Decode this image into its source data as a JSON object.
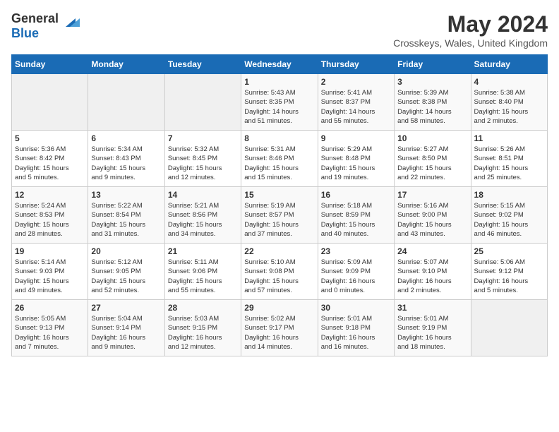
{
  "header": {
    "logo_general": "General",
    "logo_blue": "Blue",
    "month_year": "May 2024",
    "location": "Crosskeys, Wales, United Kingdom"
  },
  "weekdays": [
    "Sunday",
    "Monday",
    "Tuesday",
    "Wednesday",
    "Thursday",
    "Friday",
    "Saturday"
  ],
  "weeks": [
    [
      {
        "day": "",
        "info": ""
      },
      {
        "day": "",
        "info": ""
      },
      {
        "day": "",
        "info": ""
      },
      {
        "day": "1",
        "info": "Sunrise: 5:43 AM\nSunset: 8:35 PM\nDaylight: 14 hours\nand 51 minutes."
      },
      {
        "day": "2",
        "info": "Sunrise: 5:41 AM\nSunset: 8:37 PM\nDaylight: 14 hours\nand 55 minutes."
      },
      {
        "day": "3",
        "info": "Sunrise: 5:39 AM\nSunset: 8:38 PM\nDaylight: 14 hours\nand 58 minutes."
      },
      {
        "day": "4",
        "info": "Sunrise: 5:38 AM\nSunset: 8:40 PM\nDaylight: 15 hours\nand 2 minutes."
      }
    ],
    [
      {
        "day": "5",
        "info": "Sunrise: 5:36 AM\nSunset: 8:42 PM\nDaylight: 15 hours\nand 5 minutes."
      },
      {
        "day": "6",
        "info": "Sunrise: 5:34 AM\nSunset: 8:43 PM\nDaylight: 15 hours\nand 9 minutes."
      },
      {
        "day": "7",
        "info": "Sunrise: 5:32 AM\nSunset: 8:45 PM\nDaylight: 15 hours\nand 12 minutes."
      },
      {
        "day": "8",
        "info": "Sunrise: 5:31 AM\nSunset: 8:46 PM\nDaylight: 15 hours\nand 15 minutes."
      },
      {
        "day": "9",
        "info": "Sunrise: 5:29 AM\nSunset: 8:48 PM\nDaylight: 15 hours\nand 19 minutes."
      },
      {
        "day": "10",
        "info": "Sunrise: 5:27 AM\nSunset: 8:50 PM\nDaylight: 15 hours\nand 22 minutes."
      },
      {
        "day": "11",
        "info": "Sunrise: 5:26 AM\nSunset: 8:51 PM\nDaylight: 15 hours\nand 25 minutes."
      }
    ],
    [
      {
        "day": "12",
        "info": "Sunrise: 5:24 AM\nSunset: 8:53 PM\nDaylight: 15 hours\nand 28 minutes."
      },
      {
        "day": "13",
        "info": "Sunrise: 5:22 AM\nSunset: 8:54 PM\nDaylight: 15 hours\nand 31 minutes."
      },
      {
        "day": "14",
        "info": "Sunrise: 5:21 AM\nSunset: 8:56 PM\nDaylight: 15 hours\nand 34 minutes."
      },
      {
        "day": "15",
        "info": "Sunrise: 5:19 AM\nSunset: 8:57 PM\nDaylight: 15 hours\nand 37 minutes."
      },
      {
        "day": "16",
        "info": "Sunrise: 5:18 AM\nSunset: 8:59 PM\nDaylight: 15 hours\nand 40 minutes."
      },
      {
        "day": "17",
        "info": "Sunrise: 5:16 AM\nSunset: 9:00 PM\nDaylight: 15 hours\nand 43 minutes."
      },
      {
        "day": "18",
        "info": "Sunrise: 5:15 AM\nSunset: 9:02 PM\nDaylight: 15 hours\nand 46 minutes."
      }
    ],
    [
      {
        "day": "19",
        "info": "Sunrise: 5:14 AM\nSunset: 9:03 PM\nDaylight: 15 hours\nand 49 minutes."
      },
      {
        "day": "20",
        "info": "Sunrise: 5:12 AM\nSunset: 9:05 PM\nDaylight: 15 hours\nand 52 minutes."
      },
      {
        "day": "21",
        "info": "Sunrise: 5:11 AM\nSunset: 9:06 PM\nDaylight: 15 hours\nand 55 minutes."
      },
      {
        "day": "22",
        "info": "Sunrise: 5:10 AM\nSunset: 9:08 PM\nDaylight: 15 hours\nand 57 minutes."
      },
      {
        "day": "23",
        "info": "Sunrise: 5:09 AM\nSunset: 9:09 PM\nDaylight: 16 hours\nand 0 minutes."
      },
      {
        "day": "24",
        "info": "Sunrise: 5:07 AM\nSunset: 9:10 PM\nDaylight: 16 hours\nand 2 minutes."
      },
      {
        "day": "25",
        "info": "Sunrise: 5:06 AM\nSunset: 9:12 PM\nDaylight: 16 hours\nand 5 minutes."
      }
    ],
    [
      {
        "day": "26",
        "info": "Sunrise: 5:05 AM\nSunset: 9:13 PM\nDaylight: 16 hours\nand 7 minutes."
      },
      {
        "day": "27",
        "info": "Sunrise: 5:04 AM\nSunset: 9:14 PM\nDaylight: 16 hours\nand 9 minutes."
      },
      {
        "day": "28",
        "info": "Sunrise: 5:03 AM\nSunset: 9:15 PM\nDaylight: 16 hours\nand 12 minutes."
      },
      {
        "day": "29",
        "info": "Sunrise: 5:02 AM\nSunset: 9:17 PM\nDaylight: 16 hours\nand 14 minutes."
      },
      {
        "day": "30",
        "info": "Sunrise: 5:01 AM\nSunset: 9:18 PM\nDaylight: 16 hours\nand 16 minutes."
      },
      {
        "day": "31",
        "info": "Sunrise: 5:01 AM\nSunset: 9:19 PM\nDaylight: 16 hours\nand 18 minutes."
      },
      {
        "day": "",
        "info": ""
      }
    ]
  ]
}
